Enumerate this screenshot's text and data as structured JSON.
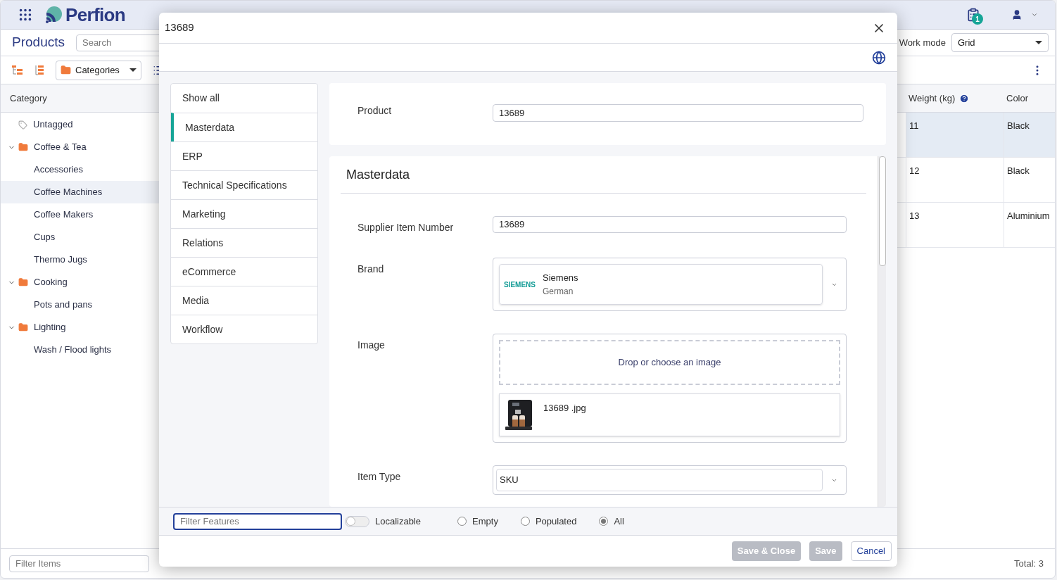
{
  "app": {
    "logo": "Perfion",
    "notification_count": "1"
  },
  "page": {
    "title": "Products",
    "search": {
      "placeholder": "Search"
    },
    "work_mode": {
      "label": "Work mode",
      "value": "Grid"
    },
    "category_view": {
      "value": "Categories"
    }
  },
  "category_tree": {
    "header": "Category",
    "items": [
      {
        "label": "Untagged",
        "kind": "tag",
        "selected": false
      },
      {
        "label": "Coffee & Tea",
        "kind": "folder",
        "expanded": true,
        "selected": false,
        "children": [
          {
            "label": "Accessories",
            "selected": false
          },
          {
            "label": "Coffee Machines",
            "selected": true
          },
          {
            "label": "Coffee Makers",
            "selected": false
          },
          {
            "label": "Cups",
            "selected": false
          },
          {
            "label": "Thermo Jugs",
            "selected": false
          }
        ]
      },
      {
        "label": "Cooking",
        "kind": "folder",
        "expanded": true,
        "selected": false,
        "children": [
          {
            "label": "Pots and pans",
            "selected": false
          }
        ]
      },
      {
        "label": "Lighting",
        "kind": "folder",
        "expanded": true,
        "selected": false,
        "children": [
          {
            "label": "Wash / Flood lights",
            "selected": false
          }
        ]
      }
    ]
  },
  "filter_items": {
    "placeholder": "Filter Items"
  },
  "grid": {
    "columns": [
      {
        "label": "Weight (kg)",
        "help": true
      },
      {
        "label": "Color",
        "help": false
      }
    ],
    "rows": [
      {
        "cells": [
          "11",
          "Black"
        ],
        "selected": true
      },
      {
        "cells": [
          "12",
          "Black"
        ],
        "selected": false
      },
      {
        "cells": [
          "13",
          "Aluminium"
        ],
        "selected": false
      }
    ],
    "total": "Total: 3"
  },
  "dialog": {
    "title": "13689",
    "nav": [
      {
        "label": "Show all",
        "selected": false
      },
      {
        "label": "Masterdata",
        "selected": true
      },
      {
        "label": "ERP",
        "selected": false
      },
      {
        "label": "Technical Specifications",
        "selected": false
      },
      {
        "label": "Marketing",
        "selected": false
      },
      {
        "label": "Relations",
        "selected": false
      },
      {
        "label": "eCommerce",
        "selected": false
      },
      {
        "label": "Media",
        "selected": false
      },
      {
        "label": "Workflow",
        "selected": false
      }
    ],
    "product": {
      "label": "Product",
      "value": "13689"
    },
    "section": {
      "title": "Masterdata",
      "fields": [
        {
          "kind": "text",
          "label": "Supplier Item Number",
          "value": "13689"
        },
        {
          "kind": "brand",
          "label": "Brand",
          "logo": "SIEMENS",
          "name": "Siemens",
          "language": "German"
        },
        {
          "label": "Image",
          "drop_text": "Drop or choose an image",
          "file": "13689 .jpg"
        },
        {
          "kind": "select",
          "label": "Item Type",
          "value": "SKU"
        }
      ]
    },
    "filter": {
      "placeholder": "Filter Features"
    },
    "localizable": {
      "label": "Localizable",
      "on": false
    },
    "radios": [
      {
        "label": "Empty",
        "selected": false
      },
      {
        "label": "Populated",
        "selected": false
      },
      {
        "label": "All",
        "selected": true
      }
    ],
    "buttons": [
      {
        "label": "Save & Close",
        "disabled": true
      },
      {
        "label": "Save",
        "disabled": true
      },
      {
        "label": "Cancel",
        "disabled": false
      }
    ]
  }
}
